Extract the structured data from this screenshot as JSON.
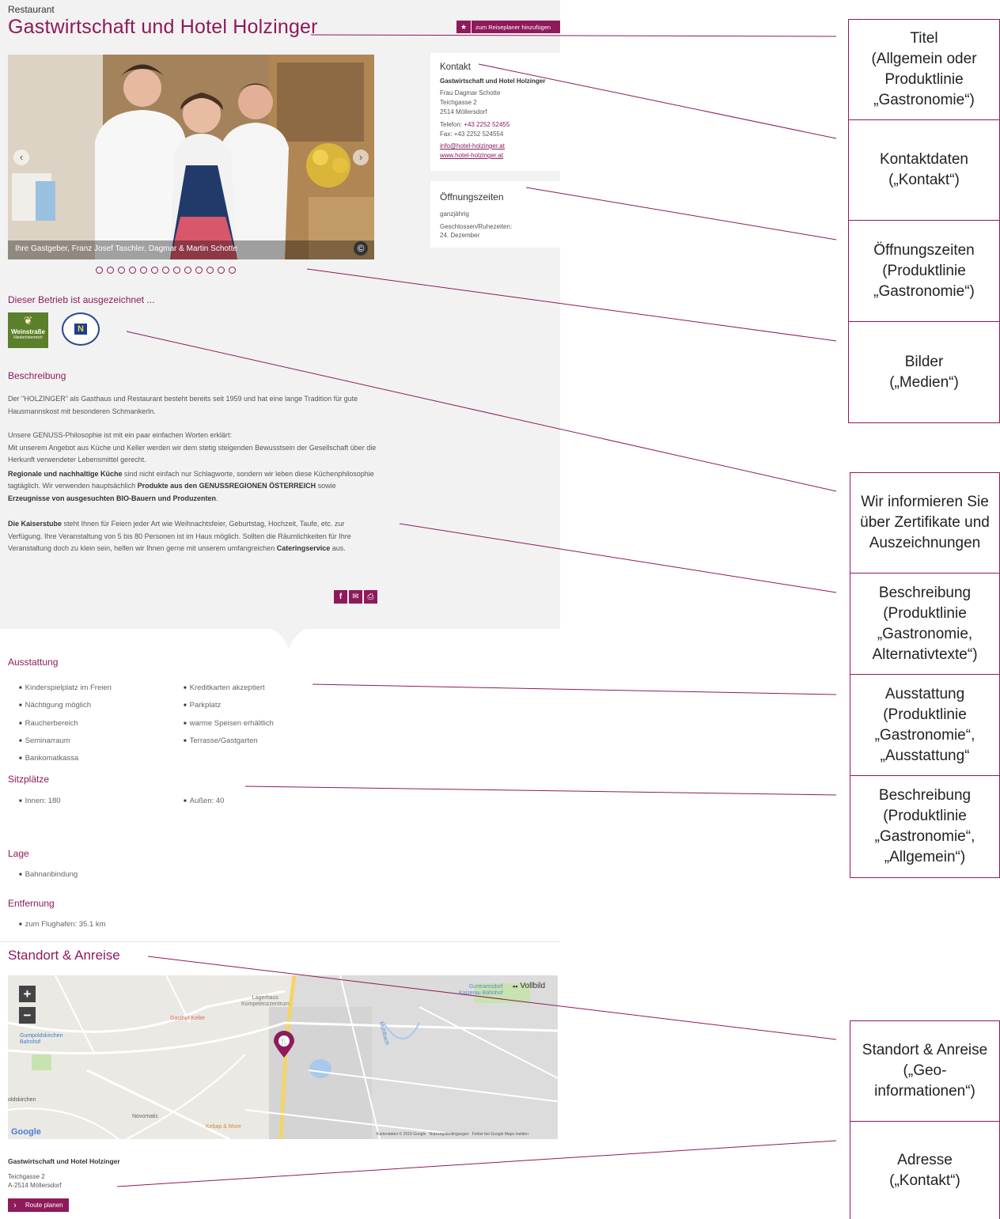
{
  "header": {
    "category": "Restaurant",
    "title": "Gastwirtschaft und Hotel Holzinger",
    "planner_button": "zum Reiseplaner hinzufügen"
  },
  "gallery": {
    "caption": "Ihre Gastgeber, Franz Josef Taschler, Dagmar & Martin Schotte",
    "dot_count": 13
  },
  "contact": {
    "heading": "Kontakt",
    "name": "Gastwirtschaft und Hotel Holzinger",
    "person": "Frau Dagmar Schotte",
    "street": "Teichgasse 2",
    "city": "2514 Möllersdorf",
    "phone_label": "Telefon:",
    "phone": "+43 2252 52455",
    "fax": "Fax: +43 2252 524554",
    "email": "info@hotel-holzinger.at",
    "web": "www.hotel-holzinger.at"
  },
  "hours": {
    "heading": "Öffnungszeiten",
    "line1": "ganzjährig",
    "line2": "Geschlossen/Ruhezeiten:",
    "line3": "24. Dezember"
  },
  "awards": {
    "heading": "Dieser Betrieb ist ausgezeichnet ...",
    "logo1_text": "Weinstraße",
    "logo1_sub": "Niederösterreich",
    "logo2_text": "N"
  },
  "description": {
    "heading": "Beschreibung",
    "p1": "Der \"HOLZINGER\" als Gasthaus und Restaurant besteht bereits seit 1959 und hat eine lange Tradition für gute Hausmannskost mit besonderen Schmankerln.",
    "p2a": "Unsere GENUSS-Philosophie ist mit ein paar einfachen Worten erklärt:",
    "p2b": "Mit unserem Angebot aus Küche und Keller werden wir dem stetig steigenden Bewusstsein der Gesellschaft über die Herkunft verwendeter Lebensmittel gerecht.",
    "p3_bold1": "Regionale und nachhaltige Küche",
    "p3_text1": " sind nicht einfach nur Schlagworte, sondern wir leben diese Küchenphilosophie tagtäglich. Wir verwenden hauptsächlich ",
    "p3_bold2": "Produkte aus den GENUSSREGIONEN ÖSTERREICH",
    "p3_text2": " sowie ",
    "p3_bold3": "Erzeugnisse von ausgesuchten BIO-Bauern und Produzenten",
    "p3_text3": ".",
    "p4_bold1": "Die Kaiserstube",
    "p4_text1": " steht Ihnen für Feiern jeder Art wie Weihnachtsfeier, Geburtstag, Hochzeit, Taufe, etc. zur Verfügung. Ihre Veranstaltung von 5 bis 80 Personen ist im Haus möglich. Sollten die Räumlichkeiten für Ihre Veranstaltung doch zu klein sein, helfen wir Ihnen gerne mit unserem umfangreichen ",
    "p4_bold2": "Cateringservice",
    "p4_text2": " aus."
  },
  "ausstattung": {
    "heading": "Ausstattung",
    "col1": [
      "Kinderspielplatz im Freien",
      "Nächtigung möglich",
      "Raucherbereich",
      "Seminarraum",
      "Bankomatkassa"
    ],
    "col2": [
      "Kreditkarten akzeptiert",
      "Parkplatz",
      "warme Speisen erhältlich",
      "Terrasse/Gastgarten"
    ]
  },
  "sitzplaetze": {
    "heading": "Sitzplätze",
    "innen": "Innen: 180",
    "aussen": "Außen: 40"
  },
  "lage": {
    "heading": "Lage",
    "item": "Bahnanbindung"
  },
  "entfernung": {
    "heading": "Entfernung",
    "item": "zum Flughafen: 35.1 km"
  },
  "standort": {
    "heading": "Standort & Anreise",
    "fullscreen": "Vollbild",
    "zoom_in": "+",
    "zoom_out": "−",
    "map_labels": {
      "guntramsdorf": "Guntramsdorf\nKaiserau Bahnhof",
      "lagerhaus": "Lagerhaus\nKompetenzzentrum",
      "gasthof_keller": "Gasthof Keller",
      "gumpoldskirchen": "Gumpoldskirchen\nBahnhof",
      "novomatic": "Novomatic",
      "kebap": "Kebap & More",
      "oldskirchen": "oldskirchen",
      "google": "Google",
      "footer": "Kartendaten © 2019 Google   Nutzungsbedingungen   Fehler bei Google Maps melden",
      "muehlbach": "Mühlbach"
    }
  },
  "address": {
    "name": "Gastwirtschaft und Hotel Holzinger",
    "street": "Teichgasse 2",
    "city": "A-2514 Möllersdorf",
    "route_button": "Route planen"
  },
  "annotations": {
    "titel": "Titel\n(Allgemein oder Produktlinie „Gastronomie“)",
    "kontakt": "Kontaktdaten\n(„Kontakt“)",
    "oeffnung": "Öffnungszeiten\n(Produktlinie „Gastronomie“)",
    "bilder": "Bilder\n(„Medien“)",
    "zertifikate": "Wir informieren Sie über Zertifikate und Auszeichnungen",
    "beschreibung1": "Beschreibung\n(Produktlinie „Gastronomie, Alternativtexte“)",
    "ausstattung": "Ausstattung\n(Produktlinie „Gastronomie“, „Ausstattung“",
    "beschreibung2": "Beschreibung\n(Produktlinie „Gastronomie“, „Allgemein“)",
    "standort": "Standort & Anreise\n(„Geo-informationen“)",
    "adresse": "Adresse\n(„Kontakt“)"
  },
  "colors": {
    "accent": "#8e1a5b",
    "panel": "#f2f2f2"
  }
}
